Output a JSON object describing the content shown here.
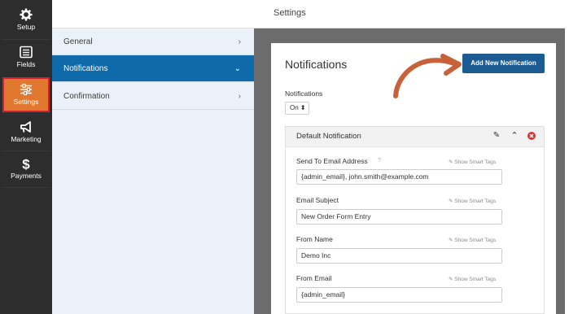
{
  "sidebar": {
    "items": [
      {
        "label": "Setup",
        "icon": "gear-icon"
      },
      {
        "label": "Fields",
        "icon": "fields-list-icon"
      },
      {
        "label": "Settings",
        "icon": "sliders-icon"
      },
      {
        "label": "Marketing",
        "icon": "megaphone-icon"
      },
      {
        "label": "Payments",
        "icon": "dollar-icon"
      }
    ]
  },
  "header": {
    "title": "Settings"
  },
  "subnav": {
    "items": [
      {
        "label": "General",
        "chevron": "›"
      },
      {
        "label": "Notifications",
        "chevron": "⌄"
      },
      {
        "label": "Confirmation",
        "chevron": "›"
      }
    ]
  },
  "panel": {
    "title": "Notifications",
    "add_button": "Add New Notification",
    "toggle_label": "Notifications",
    "toggle_value": "On ⬍"
  },
  "notification": {
    "title": "Default Notification",
    "fields": [
      {
        "label": "Send To Email Address",
        "value": "{admin_email}, john.smith@example.com",
        "smart_tags": "✎ Show Smart Tags"
      },
      {
        "label": "Email Subject",
        "value": "New Order Form Entry",
        "smart_tags": "✎ Show Smart Tags"
      },
      {
        "label": "From Name",
        "value": "Demo Inc",
        "smart_tags": "✎ Show Smart Tags"
      },
      {
        "label": "From Email",
        "value": "{admin_email}",
        "smart_tags": "✎ Show Smart Tags"
      }
    ]
  },
  "colors": {
    "rail": "#2d2d2d",
    "settings_active": "#e27730",
    "highlight_border": "#d8202a",
    "subnav_active": "#0e6aa8",
    "add_button": "#1d5c92",
    "arrow": "#c6613a"
  }
}
